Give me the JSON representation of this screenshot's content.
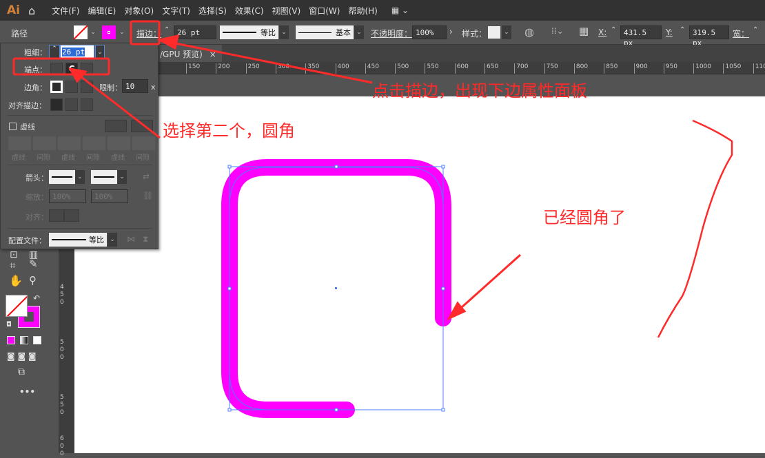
{
  "app": {
    "logo": "Ai"
  },
  "menu": [
    "文件(F)",
    "编辑(E)",
    "对象(O)",
    "文字(T)",
    "选择(S)",
    "效果(C)",
    "视图(V)",
    "窗口(W)",
    "帮助(H)"
  ],
  "control": {
    "object_type": "路径",
    "stroke_label": "描边：",
    "stroke_weight": "26 pt",
    "profile": "等比",
    "brush": "基本",
    "opacity_label": "不透明度：",
    "opacity": "100%",
    "style_label": "样式：",
    "x_label": "X:",
    "x": "431.5 px",
    "y_label": "Y:",
    "y": "319.5 px",
    "w_label": "宽："
  },
  "tab": {
    "title": "/GPU 预览)",
    "close": "×"
  },
  "ruler": [
    "150",
    "200",
    "250",
    "300",
    "350",
    "400",
    "450",
    "500",
    "550",
    "600",
    "650",
    "700",
    "750",
    "800",
    "850",
    "900",
    "950",
    "1000",
    "1050",
    "1100"
  ],
  "vruler": [
    "4 5 0",
    "5 0 0",
    "5 5 0",
    "6 0 0"
  ],
  "stroke_panel": {
    "weight_label": "粗细：",
    "weight": "26 pt",
    "cap_label": "端点：",
    "corner_label": "边角：",
    "limit_label": "限制：",
    "limit": "10",
    "limit_unit": "x",
    "align_label": "对齐描边：",
    "dashed_label": "虚线",
    "dash_fields": [
      "虚线",
      "间隙",
      "虚线",
      "间隙",
      "虚线",
      "间隙"
    ],
    "arrow_label": "箭头：",
    "scale_label": "缩放：",
    "scale1": "100%",
    "scale2": "100%",
    "align_arrow_label": "对齐：",
    "profile_label": "配置文件：",
    "profile": "等比"
  },
  "colors": {
    "stroke": "#ff00ff",
    "selection": "#4f7cff",
    "annotation": "#ff2a2a"
  },
  "annotations": {
    "click_stroke": "点击描边，出现下边属性面板",
    "choose_second": "选择第二个，圆角",
    "rounded": "已经圆角了"
  }
}
